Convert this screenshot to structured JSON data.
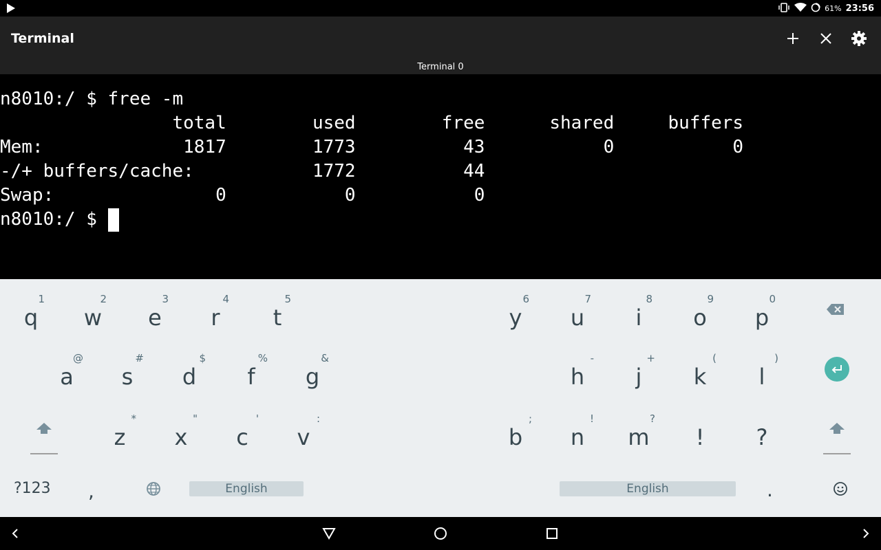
{
  "status": {
    "battery": "61%",
    "time": "23:56"
  },
  "app": {
    "title": "Terminal",
    "tab": "Terminal 0"
  },
  "terminal": {
    "lines": [
      "n8010:/ $ free -m",
      "                total        used        free      shared     buffers",
      "Mem:             1817        1773          43           0           0",
      "-/+ buffers/cache:           1772          44",
      "Swap:               0           0           0",
      "n8010:/ $ "
    ]
  },
  "keyboard": {
    "row1_left": [
      {
        "k": "q",
        "h": "1"
      },
      {
        "k": "w",
        "h": "2"
      },
      {
        "k": "e",
        "h": "3"
      },
      {
        "k": "r",
        "h": "4"
      },
      {
        "k": "t",
        "h": "5"
      }
    ],
    "row1_right": [
      {
        "k": "y",
        "h": "6"
      },
      {
        "k": "u",
        "h": "7"
      },
      {
        "k": "i",
        "h": "8"
      },
      {
        "k": "o",
        "h": "9"
      },
      {
        "k": "p",
        "h": "0"
      }
    ],
    "row2_left": [
      {
        "k": "a",
        "h": "@"
      },
      {
        "k": "s",
        "h": "#"
      },
      {
        "k": "d",
        "h": "$"
      },
      {
        "k": "f",
        "h": "%"
      },
      {
        "k": "g",
        "h": "&"
      }
    ],
    "row2_right": [
      {
        "k": "h",
        "h": "-"
      },
      {
        "k": "j",
        "h": "+"
      },
      {
        "k": "k",
        "h": "("
      },
      {
        "k": "l",
        "h": ")"
      }
    ],
    "row3_left": [
      {
        "k": "z",
        "h": "*"
      },
      {
        "k": "x",
        "h": "\""
      },
      {
        "k": "c",
        "h": "'"
      },
      {
        "k": "v",
        "h": ":"
      }
    ],
    "row3_right": [
      {
        "k": "b",
        "h": ";"
      },
      {
        "k": "n",
        "h": "!"
      },
      {
        "k": "m",
        "h": "?"
      },
      {
        "k": "!",
        "h": ""
      },
      {
        "k": "?",
        "h": ""
      }
    ],
    "symbols_label": "?123",
    "comma": ",",
    "period": ".",
    "space_label_left": "English",
    "space_label_right": "English"
  }
}
